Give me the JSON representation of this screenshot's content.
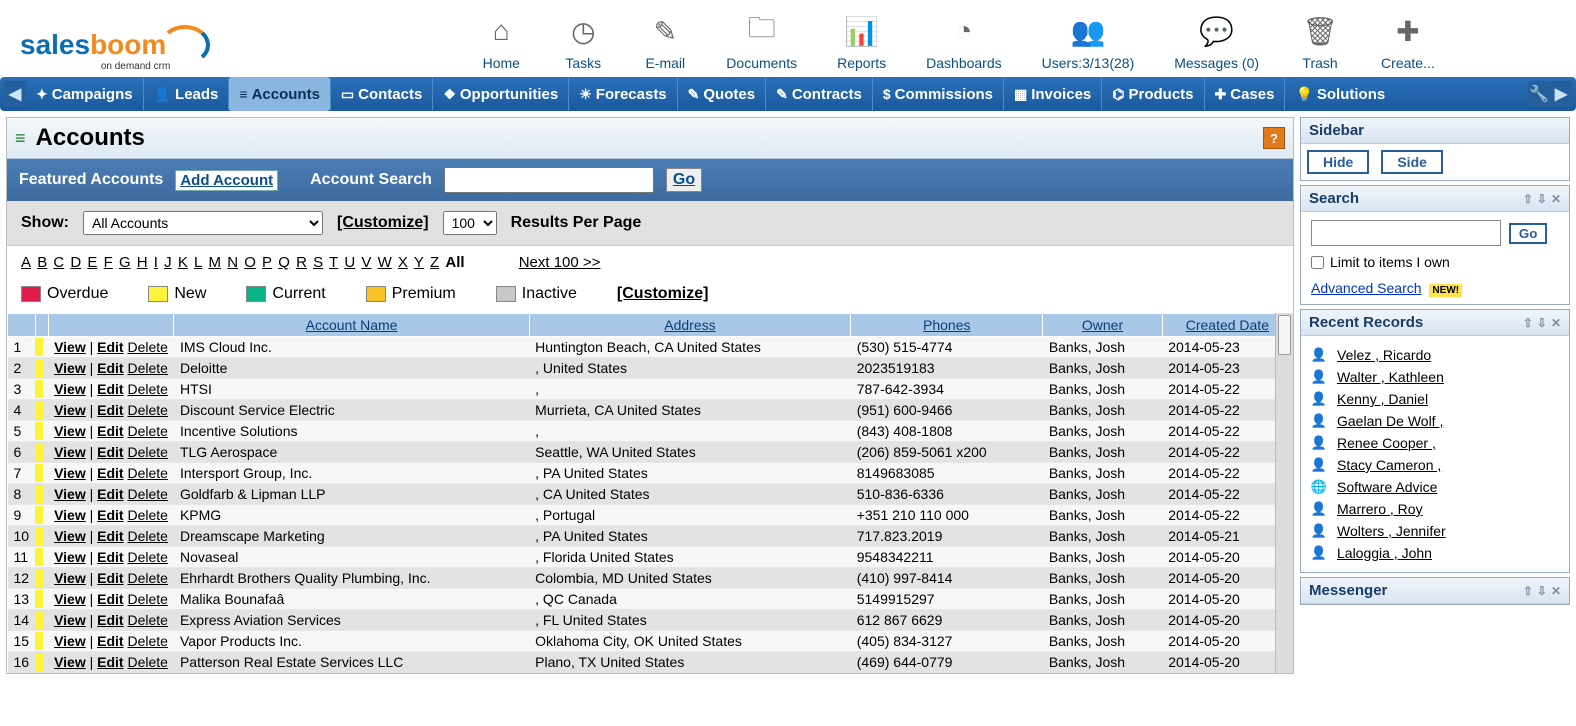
{
  "logo": {
    "part1": "sales",
    "part2": "boom",
    "tagline": "on demand crm"
  },
  "toolbar": [
    {
      "name": "home",
      "label": "Home",
      "glyph": "⌂"
    },
    {
      "name": "tasks",
      "label": "Tasks",
      "glyph": "◷"
    },
    {
      "name": "email",
      "label": "E-mail",
      "glyph": "✎"
    },
    {
      "name": "documents",
      "label": "Documents",
      "glyph": "🗀"
    },
    {
      "name": "reports",
      "label": "Reports",
      "glyph": "📊"
    },
    {
      "name": "dashboards",
      "label": "Dashboards",
      "glyph": "◔"
    },
    {
      "name": "users",
      "label": "Users:3/13(28)",
      "glyph": "👥"
    },
    {
      "name": "messages",
      "label": "Messages (0)",
      "glyph": "💬"
    },
    {
      "name": "trash",
      "label": "Trash",
      "glyph": "🗑"
    },
    {
      "name": "create",
      "label": "Create...",
      "glyph": "✚"
    }
  ],
  "nav": {
    "items": [
      {
        "name": "campaigns",
        "label": "Campaigns",
        "icon": "✦"
      },
      {
        "name": "leads",
        "label": "Leads",
        "icon": "👤"
      },
      {
        "name": "accounts",
        "label": "Accounts",
        "icon": "≡",
        "active": true
      },
      {
        "name": "contacts",
        "label": "Contacts",
        "icon": "▭"
      },
      {
        "name": "opportunities",
        "label": "Opportunities",
        "icon": "❖"
      },
      {
        "name": "forecasts",
        "label": "Forecasts",
        "icon": "☀"
      },
      {
        "name": "quotes",
        "label": "Quotes",
        "icon": "✎"
      },
      {
        "name": "contracts",
        "label": "Contracts",
        "icon": "✎"
      },
      {
        "name": "commissions",
        "label": "Commissions",
        "icon": "$"
      },
      {
        "name": "invoices",
        "label": "Invoices",
        "icon": "▦"
      },
      {
        "name": "products",
        "label": "Products",
        "icon": "⌬"
      },
      {
        "name": "cases",
        "label": "Cases",
        "icon": "✚"
      },
      {
        "name": "solutions",
        "label": "Solutions",
        "icon": "💡"
      }
    ]
  },
  "page": {
    "title": "Accounts",
    "featured": "Featured Accounts",
    "add_label": "Add Account",
    "search_label": "Account Search",
    "go": "Go",
    "show_label": "Show:",
    "show_value": "All Accounts",
    "customize": "[Customize]",
    "per_page_value": "100",
    "per_page_label": "Results Per Page",
    "alphabet": [
      "A",
      "B",
      "C",
      "D",
      "E",
      "F",
      "G",
      "H",
      "I",
      "J",
      "K",
      "L",
      "M",
      "N",
      "O",
      "P",
      "Q",
      "R",
      "S",
      "T",
      "U",
      "V",
      "W",
      "X",
      "Y",
      "Z"
    ],
    "all": "All",
    "next": "Next 100 >>",
    "legend": {
      "overdue": "Overdue",
      "new": "New",
      "current": "Current",
      "premium": "Premium",
      "inactive": "Inactive",
      "customize": "[Customize]"
    },
    "columns": {
      "name": "Account Name",
      "address": "Address",
      "phones": "Phones",
      "owner": "Owner",
      "created": "Created Date"
    },
    "actions": {
      "view": "View",
      "edit": "Edit",
      "del": "Delete"
    }
  },
  "rows": [
    {
      "n": 1,
      "name": "IMS Cloud Inc.",
      "addr": "Huntington Beach, CA United States",
      "phone": "(530) 515-4774",
      "owner": "Banks, Josh",
      "created": "2014-05-23"
    },
    {
      "n": 2,
      "name": "Deloitte",
      "addr": ", United States",
      "phone": "2023519183",
      "owner": "Banks, Josh",
      "created": "2014-05-23"
    },
    {
      "n": 3,
      "name": "HTSI",
      "addr": ",",
      "phone": "787-642-3934",
      "owner": "Banks, Josh",
      "created": "2014-05-22"
    },
    {
      "n": 4,
      "name": "Discount Service Electric",
      "addr": "Murrieta, CA United States",
      "phone": "(951) 600-9466",
      "owner": "Banks, Josh",
      "created": "2014-05-22"
    },
    {
      "n": 5,
      "name": "Incentive Solutions",
      "addr": ",",
      "phone": "(843) 408-1808",
      "owner": "Banks, Josh",
      "created": "2014-05-22"
    },
    {
      "n": 6,
      "name": "TLG Aerospace",
      "addr": "Seattle, WA United States",
      "phone": "(206) 859-5061 x200",
      "owner": "Banks, Josh",
      "created": "2014-05-22"
    },
    {
      "n": 7,
      "name": "Intersport Group, Inc.",
      "addr": ", PA United States",
      "phone": "8149683085",
      "owner": "Banks, Josh",
      "created": "2014-05-22"
    },
    {
      "n": 8,
      "name": "Goldfarb & Lipman LLP",
      "addr": ", CA United States",
      "phone": "510-836-6336",
      "owner": "Banks, Josh",
      "created": "2014-05-22"
    },
    {
      "n": 9,
      "name": "KPMG",
      "addr": ", Portugal",
      "phone": "+351 210 110 000",
      "owner": "Banks, Josh",
      "created": "2014-05-22"
    },
    {
      "n": 10,
      "name": "Dreamscape Marketing",
      "addr": ", PA United States",
      "phone": "717.823.2019",
      "owner": "Banks, Josh",
      "created": "2014-05-21"
    },
    {
      "n": 11,
      "name": "Novaseal",
      "addr": ", Florida United States",
      "phone": "9548342211",
      "owner": "Banks, Josh",
      "created": "2014-05-20"
    },
    {
      "n": 12,
      "name": "Ehrhardt Brothers Quality Plumbing, Inc.",
      "addr": "Colombia, MD United States",
      "phone": "(410) 997-8414",
      "owner": "Banks, Josh",
      "created": "2014-05-20"
    },
    {
      "n": 13,
      "name": "Malika Bounafaâ",
      "addr": ", QC Canada",
      "phone": "5149915297",
      "owner": "Banks, Josh",
      "created": "2014-05-20"
    },
    {
      "n": 14,
      "name": "Express Aviation Services",
      "addr": ", FL United States",
      "phone": "612 867 6629",
      "owner": "Banks, Josh",
      "created": "2014-05-20"
    },
    {
      "n": 15,
      "name": "Vapor Products Inc.",
      "addr": "Oklahoma City, OK United States",
      "phone": "(405) 834-3127",
      "owner": "Banks, Josh",
      "created": "2014-05-20"
    },
    {
      "n": 16,
      "name": "Patterson Real Estate Services LLC",
      "addr": "Plano, TX United States",
      "phone": "(469) 644-0779",
      "owner": "Banks, Josh",
      "created": "2014-05-20"
    }
  ],
  "sidebar": {
    "title": "Sidebar",
    "hide": "Hide",
    "side": "Side",
    "search_title": "Search",
    "go": "Go",
    "limit": "Limit to items I own",
    "advanced": "Advanced Search",
    "new": "NEW!",
    "recent_title": "Recent Records",
    "recent": [
      {
        "label": "Velez , Ricardo",
        "icon": "person"
      },
      {
        "label": "Walter , Kathleen",
        "icon": "person"
      },
      {
        "label": "Kenny , Daniel",
        "icon": "person"
      },
      {
        "label": "Gaelan De Wolf ,",
        "icon": "person"
      },
      {
        "label": "Renee Cooper ,",
        "icon": "person"
      },
      {
        "label": "Stacy Cameron ,",
        "icon": "person"
      },
      {
        "label": "Software Advice",
        "icon": "globe"
      },
      {
        "label": "Marrero , Roy",
        "icon": "person"
      },
      {
        "label": "Wolters , Jennifer",
        "icon": "person"
      },
      {
        "label": "Laloggia , John",
        "icon": "person"
      }
    ],
    "messenger_title": "Messenger"
  }
}
